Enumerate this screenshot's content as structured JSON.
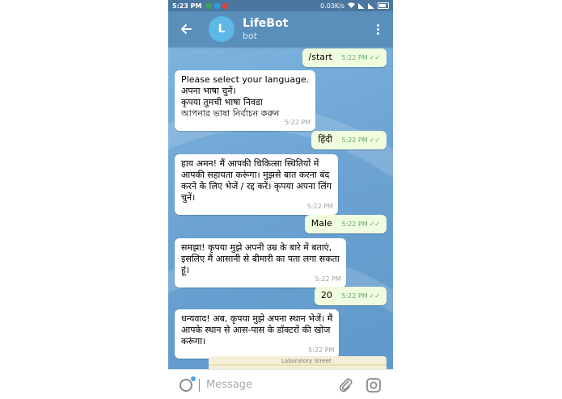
{
  "status_bar": {
    "time": "5:23 PM",
    "network_speed": "0.03K/s",
    "notification_colors": [
      "#3ba55c",
      "#2d9be0",
      "#d9443b"
    ]
  },
  "header": {
    "avatar_letter": "L",
    "title": "LifeBot",
    "subtitle": "bot",
    "back_icon": "arrow-left-icon",
    "menu_icon": "more-vert-icon"
  },
  "messages": [
    {
      "direction": "out",
      "text": "/start",
      "time": "5:22 PM",
      "ticks": "✓✓"
    },
    {
      "direction": "in",
      "lines": [
        "Please select your language.",
        "अपना भाषा चुनें।",
        "कृपया तुमची भाषा निवडा",
        "আপনার ভাষা নির্বাচন করুন"
      ],
      "time": "5:22 PM"
    },
    {
      "direction": "out",
      "text": "हिंदी",
      "time": "5:22 PM",
      "ticks": "✓✓"
    },
    {
      "direction": "in",
      "lines": [
        "हाय अमन! मैं आपकी चिकित्सा स्थितियों में",
        "आपकी सहायता करूंगा। मुझसे बात करना बंद",
        "करने के लिए भेजें / रद्द करें।  कृपया अपना लिंग",
        "चुनें।"
      ],
      "time": "5:22 PM"
    },
    {
      "direction": "out",
      "text": "Male",
      "time": "5:22 PM",
      "ticks": "✓✓"
    },
    {
      "direction": "in",
      "lines": [
        "समझा! कृपया मुझे अपनी उम्र के बारे में बताएं,",
        "इसलिए मैं आसानी से बीमारी का पता लगा सकता",
        "हूं।"
      ],
      "time": "5:22 PM"
    },
    {
      "direction": "out",
      "text": "20",
      "time": "5:22 PM",
      "ticks": "✓✓"
    },
    {
      "direction": "in",
      "lines": [
        "धन्यवाद! अब, कृपया मुझे अपना स्थान भेजें। मैं",
        "आपके स्थान से आस-पास के डॉक्टरों की खोज",
        "करूंगा।"
      ],
      "time": "5:22 PM"
    }
  ],
  "map_preview": {
    "street": "Laboratory Street"
  },
  "input": {
    "placeholder": "Message"
  },
  "colors": {
    "header": "#5a8fbb",
    "status_bar": "#4a77a0",
    "outgoing_bubble": "#effdde",
    "incoming_bubble": "#ffffff",
    "accent": "#4d9ee6"
  }
}
